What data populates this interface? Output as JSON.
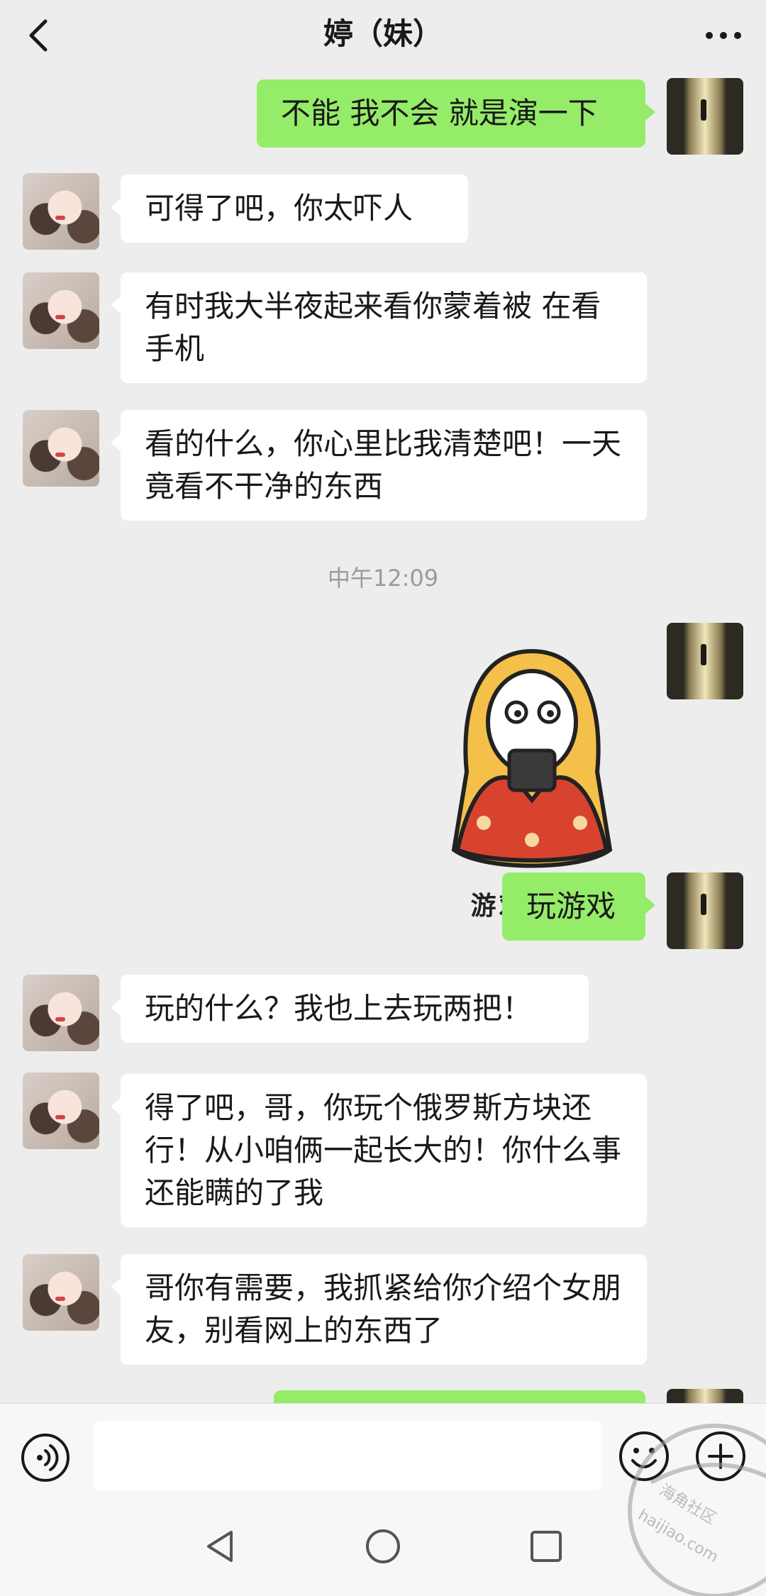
{
  "header": {
    "title": "婷（妹）",
    "back_icon": "chevron-left-icon",
    "more_icon": "more-dots-icon"
  },
  "messages": [
    {
      "side": "out",
      "text": "不能 我不会 就是演一下"
    },
    {
      "side": "in",
      "text": "可得了吧，你太吓人"
    },
    {
      "side": "in",
      "text": "有时我大半夜起来看你蒙着被 在看手机"
    },
    {
      "side": "in",
      "text": "看的什么，你心里比我清楚吧！一天竟看不干净的东西"
    },
    {
      "side": "time",
      "text": "中午12:09"
    },
    {
      "side": "out",
      "type": "sticker",
      "caption": "游戏中..."
    },
    {
      "side": "out",
      "text": "玩游戏"
    },
    {
      "side": "in",
      "text": "玩的什么？我也上去玩两把！"
    },
    {
      "side": "in",
      "text": "得了吧，哥，你玩个俄罗斯方块还行！从小咱俩一起长大的！你什么事还能瞒的了我"
    },
    {
      "side": "in",
      "text": "哥你有需要，我抓紧给你介绍个女朋友，别看网上的东西了"
    }
  ],
  "input_bar": {
    "voice_icon": "voice-icon",
    "emoji_icon": "emoji-icon",
    "plus_icon": "plus-icon",
    "text_value": ""
  },
  "nav_bar": {
    "back_icon": "triangle-back-icon",
    "home_icon": "circle-home-icon",
    "recent_icon": "square-recent-icon"
  },
  "watermark": {
    "brand": "海角社区",
    "domain": "haijiao.com"
  },
  "colors": {
    "background": "#ededed",
    "incoming_bubble": "#ffffff",
    "outgoing_bubble": "#95ec69",
    "timestamp": "#9b9b9b"
  }
}
